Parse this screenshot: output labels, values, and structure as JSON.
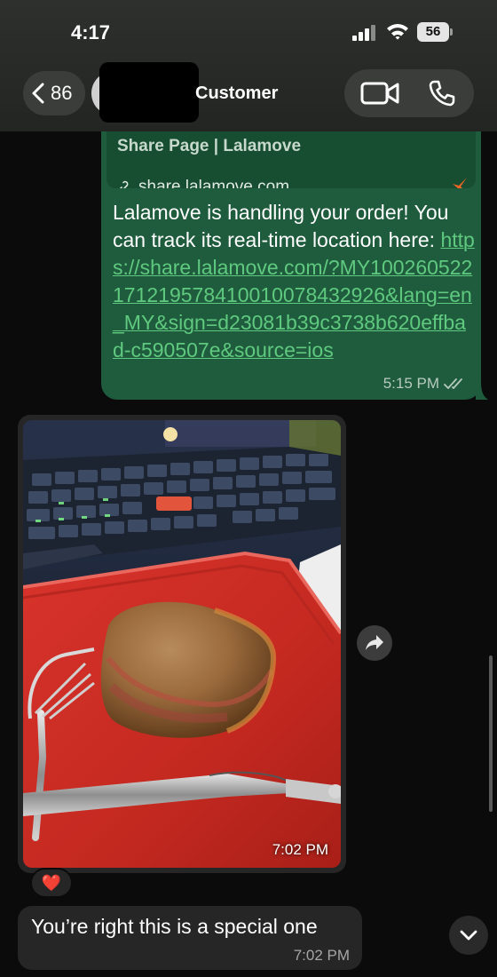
{
  "status_bar": {
    "time": "4:17",
    "battery_level": "56"
  },
  "header": {
    "back_count": "86",
    "contact_name": "Customer"
  },
  "messages": {
    "link_message": {
      "preview_title": "Share Page | Lalamove",
      "preview_domain": "share.lalamove.com",
      "text": "Lalamove is handling your order! You can track its real-time location here: ",
      "url": "https://share.lalamove.com/?MY100260522171219578410010078432926&lang=en_MY&sign=d23081b39c3738b620effbad-c590507e&source=ios",
      "time": "5:15 PM"
    },
    "photo_message": {
      "time": "7:02 PM",
      "reaction": "❤️"
    },
    "text_message": {
      "text": "You’re right this is a special one",
      "time": "7:02 PM"
    }
  },
  "colors": {
    "outgoing_bubble": "#1f5c3d",
    "incoming_bubble": "#262626",
    "link": "#5fc97f",
    "background": "#0b0b0b"
  }
}
